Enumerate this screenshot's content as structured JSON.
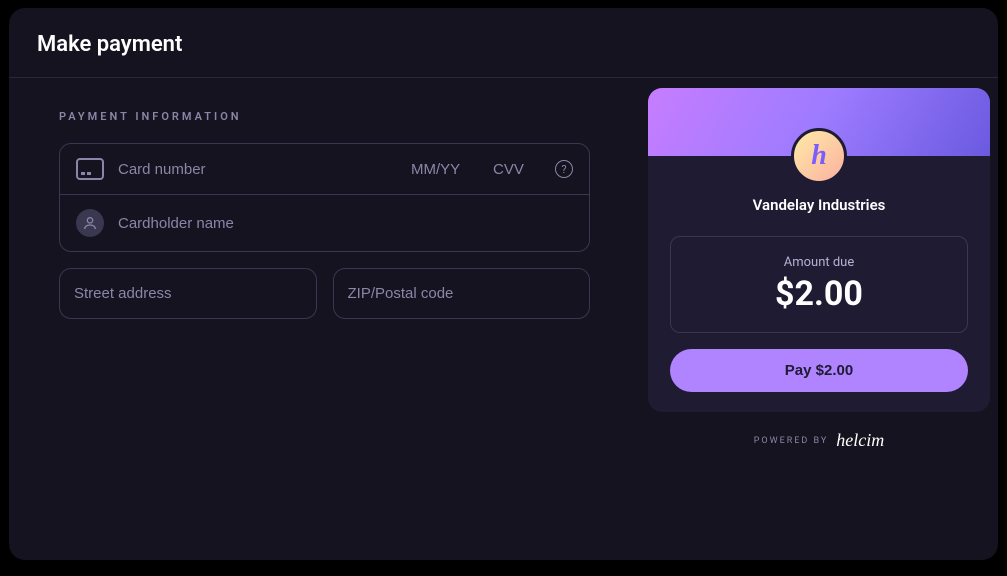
{
  "header": {
    "title": "Make payment"
  },
  "section": {
    "label": "PAYMENT INFORMATION"
  },
  "card": {
    "number_placeholder": "Card number",
    "expiry_placeholder": "MM/YY",
    "cvv_placeholder": "CVV",
    "name_placeholder": "Cardholder name"
  },
  "address": {
    "street_placeholder": "Street address",
    "zip_placeholder": "ZIP/Postal code"
  },
  "summary": {
    "logo_letter": "h",
    "merchant": "Vandelay Industries",
    "amount_label": "Amount due",
    "amount_value": "$2.00",
    "pay_label": "Pay $2.00"
  },
  "footer": {
    "powered_label": "POWERED BY",
    "brand": "helcim"
  }
}
